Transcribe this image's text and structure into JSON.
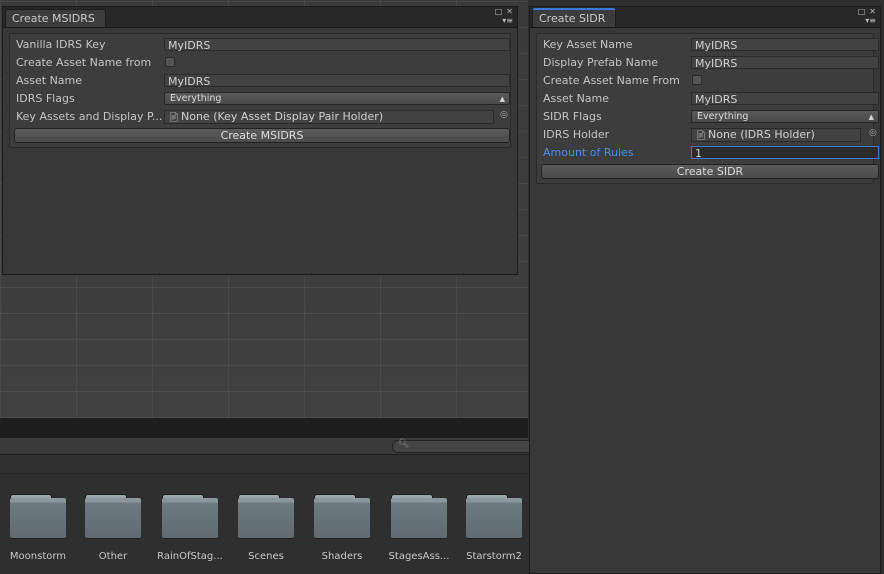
{
  "left_window": {
    "tab_title": "Create MSIDRS",
    "rows": [
      {
        "label": "Vanilla IDRS Key",
        "value": "MyIDRS"
      },
      {
        "label": "Create Asset Name from"
      },
      {
        "label": "Asset Name",
        "value": "MyIDRS"
      },
      {
        "label": "IDRS Flags",
        "value": "Everything"
      },
      {
        "label": "Key Assets and Display P...",
        "value": "None (Key Asset Display Pair Holder)"
      }
    ],
    "button": "Create MSIDRS"
  },
  "right_window": {
    "tab_title": "Create SIDR",
    "rows": [
      {
        "label": "Key Asset Name",
        "value": "MyIDRS"
      },
      {
        "label": "Display Prefab Name",
        "value": "MyIDRS"
      },
      {
        "label": "Create Asset Name From"
      },
      {
        "label": "Asset Name",
        "value": "MyIDRS"
      },
      {
        "label": "SIDR Flags",
        "value": "Everything"
      },
      {
        "label": "IDRS Holder",
        "value": "None (IDRS Holder)"
      },
      {
        "label": "Amount of Rules",
        "value": "1"
      }
    ],
    "button": "Create SIDR"
  },
  "project": {
    "search_icon": "search-icon",
    "folders": [
      "Moonstorm",
      "Other",
      "RainOfStag...",
      "Scenes",
      "Shaders",
      "StagesAss...",
      "Starstorm2"
    ]
  },
  "colors": {
    "accent": "#3a79d8",
    "focus_label": "#4a8ef0",
    "folder": "#6d7a80"
  }
}
